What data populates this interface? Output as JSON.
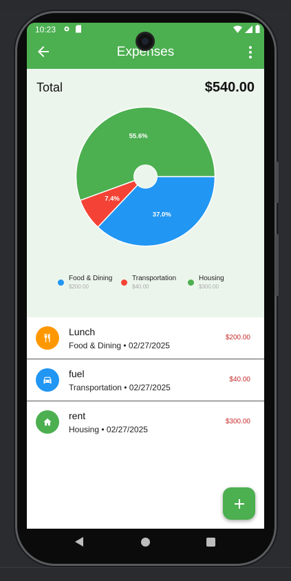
{
  "status_bar": {
    "time": "10:23"
  },
  "app_bar": {
    "title": "Expenses"
  },
  "summary": {
    "total_label": "Total",
    "total_value": "$540.00"
  },
  "chart_data": {
    "type": "pie",
    "slices": [
      {
        "name": "Food & Dining",
        "value": 200,
        "percent": 37.0,
        "percent_label": "37.0%",
        "color": "#2196f3"
      },
      {
        "name": "Transportation",
        "value": 40,
        "percent": 7.4,
        "percent_label": "7.4%",
        "color": "#f44336"
      },
      {
        "name": "Housing",
        "value": 300,
        "percent": 55.6,
        "percent_label": "55.6%",
        "color": "#4caf50"
      }
    ],
    "legend_placement": "bottom"
  },
  "legend": [
    {
      "name": "Food & Dining",
      "amount": "$200.00",
      "color": "#2196f3"
    },
    {
      "name": "Transportation",
      "amount": "$40.00",
      "color": "#f44336"
    },
    {
      "name": "Housing",
      "amount": "$300.00",
      "color": "#4caf50"
    }
  ],
  "expenses": [
    {
      "title": "Lunch",
      "subtitle": "Food & Dining • 02/27/2025",
      "amount": "$200.00",
      "icon": "restaurant-icon",
      "color": "#ff9800"
    },
    {
      "title": "fuel",
      "subtitle": "Transportation • 02/27/2025",
      "amount": "$40.00",
      "icon": "car-icon",
      "color": "#2196f3"
    },
    {
      "title": "rent",
      "subtitle": "Housing • 02/27/2025",
      "amount": "$300.00",
      "icon": "home-icon",
      "color": "#4caf50"
    }
  ],
  "colors": {
    "primary": "#4caf50",
    "summary_bg": "#ecf5ec",
    "amount": "#c62828"
  }
}
